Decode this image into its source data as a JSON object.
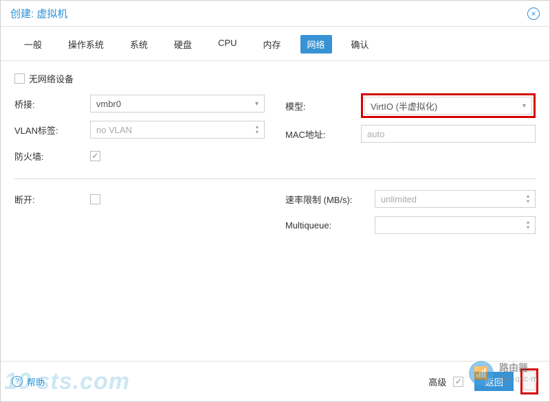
{
  "title": "创建: 虚拟机",
  "tabs": [
    {
      "label": "一般"
    },
    {
      "label": "操作系统"
    },
    {
      "label": "系统"
    },
    {
      "label": "硬盘"
    },
    {
      "label": "CPU"
    },
    {
      "label": "内存"
    },
    {
      "label": "网络",
      "active": true
    },
    {
      "label": "确认"
    }
  ],
  "no_network_label": "无网络设备",
  "left": {
    "bridge_label": "桥接:",
    "bridge_value": "vmbr0",
    "vlan_label": "VLAN标签:",
    "vlan_value": "no VLAN",
    "firewall_label": "防火墙:",
    "disconnect_label": "断开:"
  },
  "right": {
    "model_label": "模型:",
    "model_value": "VirtIO (半虚拟化)",
    "mac_label": "MAC地址:",
    "mac_value": "auto",
    "rate_label": "速率限制 (MB/s):",
    "rate_value": "unlimited",
    "multiqueue_label": "Multiqueue:",
    "multiqueue_value": ""
  },
  "footer": {
    "help": "帮助",
    "advanced": "高级",
    "back": "返回"
  },
  "watermarks": {
    "left": "10 sts.com",
    "router_title": "路由器",
    "router_sub": "uyo·qi.c·m"
  }
}
